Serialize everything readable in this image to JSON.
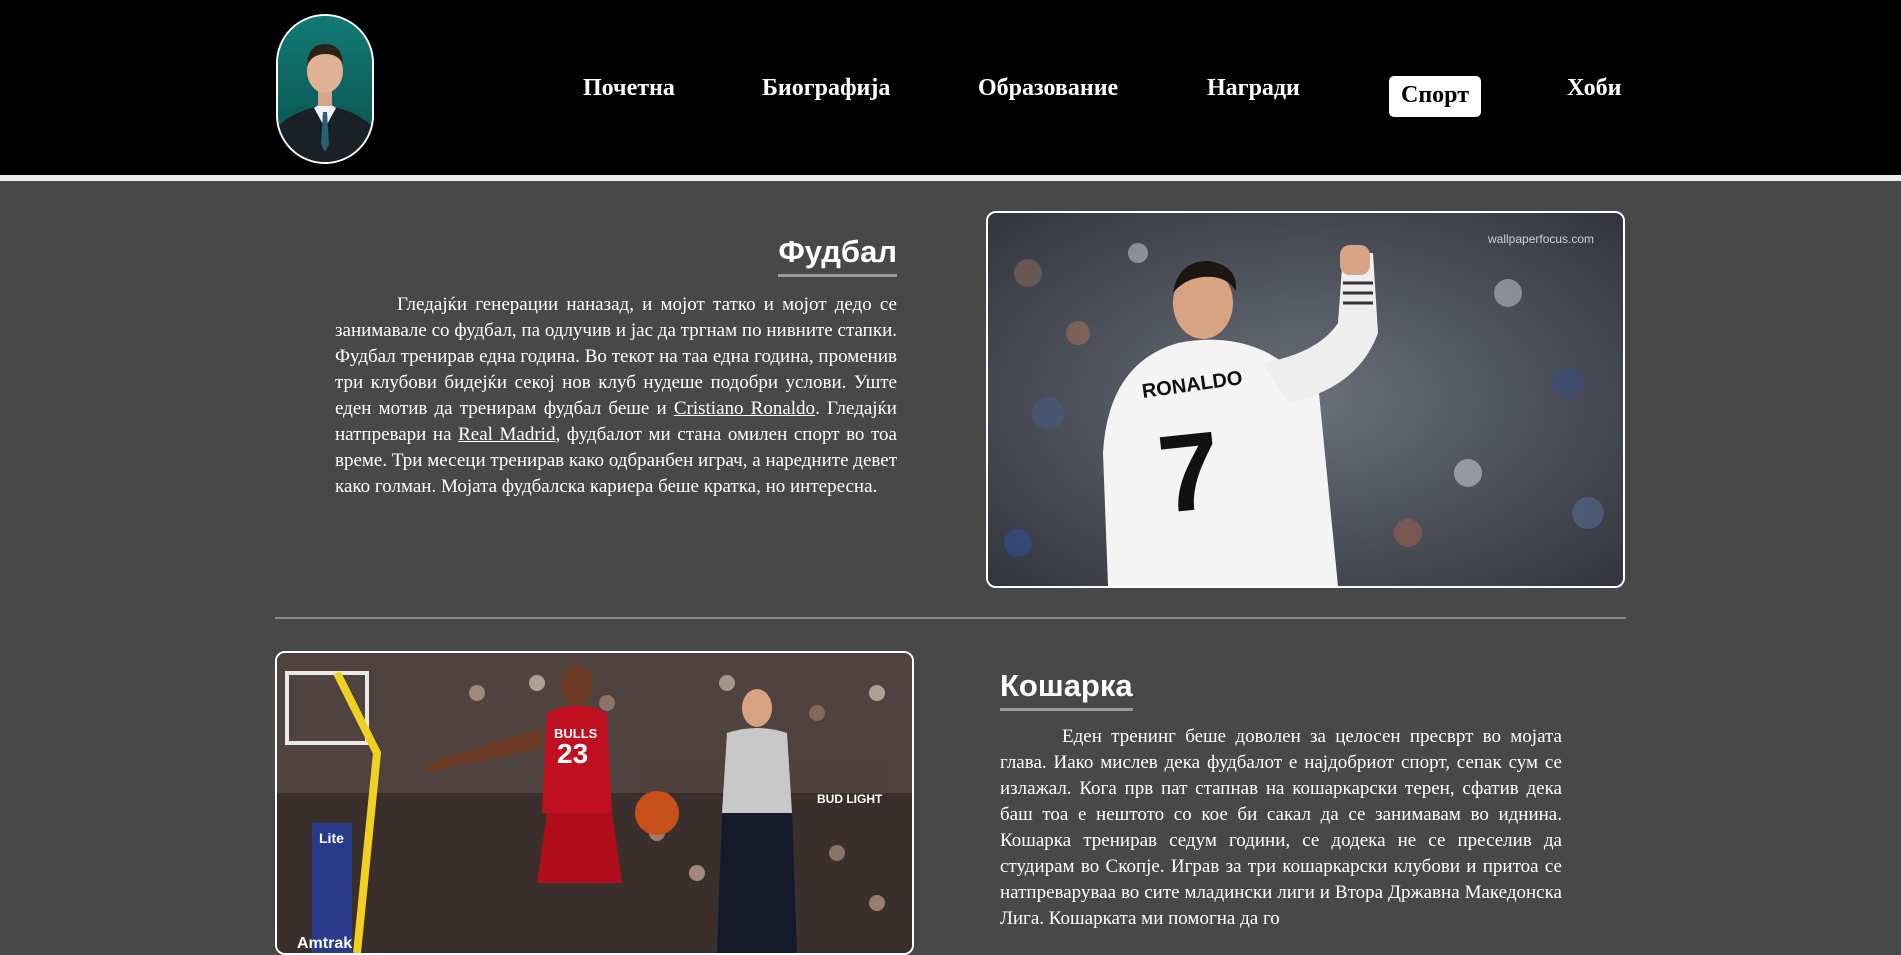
{
  "nav": {
    "items": [
      {
        "label": "Почетна"
      },
      {
        "label": "Биографија"
      },
      {
        "label": "Образование"
      },
      {
        "label": "Награди"
      },
      {
        "label": "Спорт"
      },
      {
        "label": "Хоби"
      }
    ],
    "active": "Спорт"
  },
  "football": {
    "title": "Фудбал",
    "text_1": "Гледајќи генерации наназад, и мојот татко и мојот дедо се занимавале со фудбал, па одлучив и јас да тргнам по нивните стапки. Фудбал тренирав една година. Во текот на таа една година, променив три клубови бидејќи секој нов клуб нудеше подобри услови. Уште еден мотив да тренирам фудбал беше и ",
    "link_1": "Cristiano Ronaldo",
    "text_2": ". Гледајќи натпревари на ",
    "link_2": "Real Madrid",
    "text_3": ", фудбалот ми стана омилен спорт во тоа време. Три месеци тренирав како одбранбен играч, а наредните девет како голман. Мојата фудбалска кариера беше кратка, но интересна.",
    "watermark": "wallpaperfocus.com",
    "jersey_name": "RONALDO",
    "jersey_number": "7"
  },
  "basketball": {
    "title": "Кошарка",
    "text": "Еден тренинг беше доволен за целосен пресврт во мојата глава. Иако мислев дека фудбалот е најдобриот спорт, сепак сум се излажал. Кога прв пат стапнав на кошаркарски терен, сфатив дека баш тоа е нештото со кое би сакал да се занимавам во иднина. Кошарка тренирав седум години, се додека не се преселив да студирам во Скопје. Играв за три кошаркарски клубови и притоа се натпреваруваа во сите младински лиги и Втора Државна Македонска Лига. Кошарката ми помогна да го",
    "jersey_team": "BULLS",
    "jersey_number": "23",
    "sign_1": "Lite",
    "sign_2": "Amtrak",
    "sign_3": "BUD LIGHT"
  }
}
